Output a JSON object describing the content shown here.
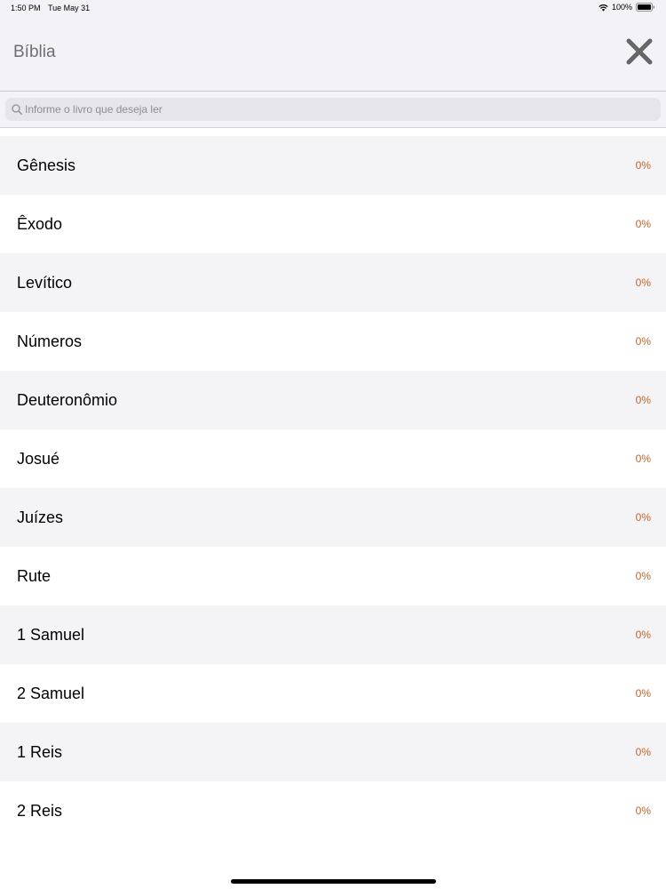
{
  "status_bar": {
    "time": "1:50 PM",
    "date": "Tue May 31",
    "battery": "100%"
  },
  "header": {
    "title": "Bíblia",
    "close_icon": "close-icon"
  },
  "search": {
    "placeholder": "Informe o livro que deseja ler",
    "value": ""
  },
  "books": [
    {
      "name": "Gênesis",
      "progress": "0%"
    },
    {
      "name": "Êxodo",
      "progress": "0%"
    },
    {
      "name": "Levítico",
      "progress": "0%"
    },
    {
      "name": "Números",
      "progress": "0%"
    },
    {
      "name": "Deuteronômio",
      "progress": "0%"
    },
    {
      "name": "Josué",
      "progress": "0%"
    },
    {
      "name": "Juízes",
      "progress": "0%"
    },
    {
      "name": "Rute",
      "progress": "0%"
    },
    {
      "name": "1 Samuel",
      "progress": "0%"
    },
    {
      "name": "2 Samuel",
      "progress": "0%"
    },
    {
      "name": "1 Reis",
      "progress": "0%"
    },
    {
      "name": "2 Reis",
      "progress": "0%"
    }
  ],
  "colors": {
    "progress_text": "#c0622a",
    "header_background": "#f2f2f7",
    "alternate_row": "#f4f4f6"
  }
}
